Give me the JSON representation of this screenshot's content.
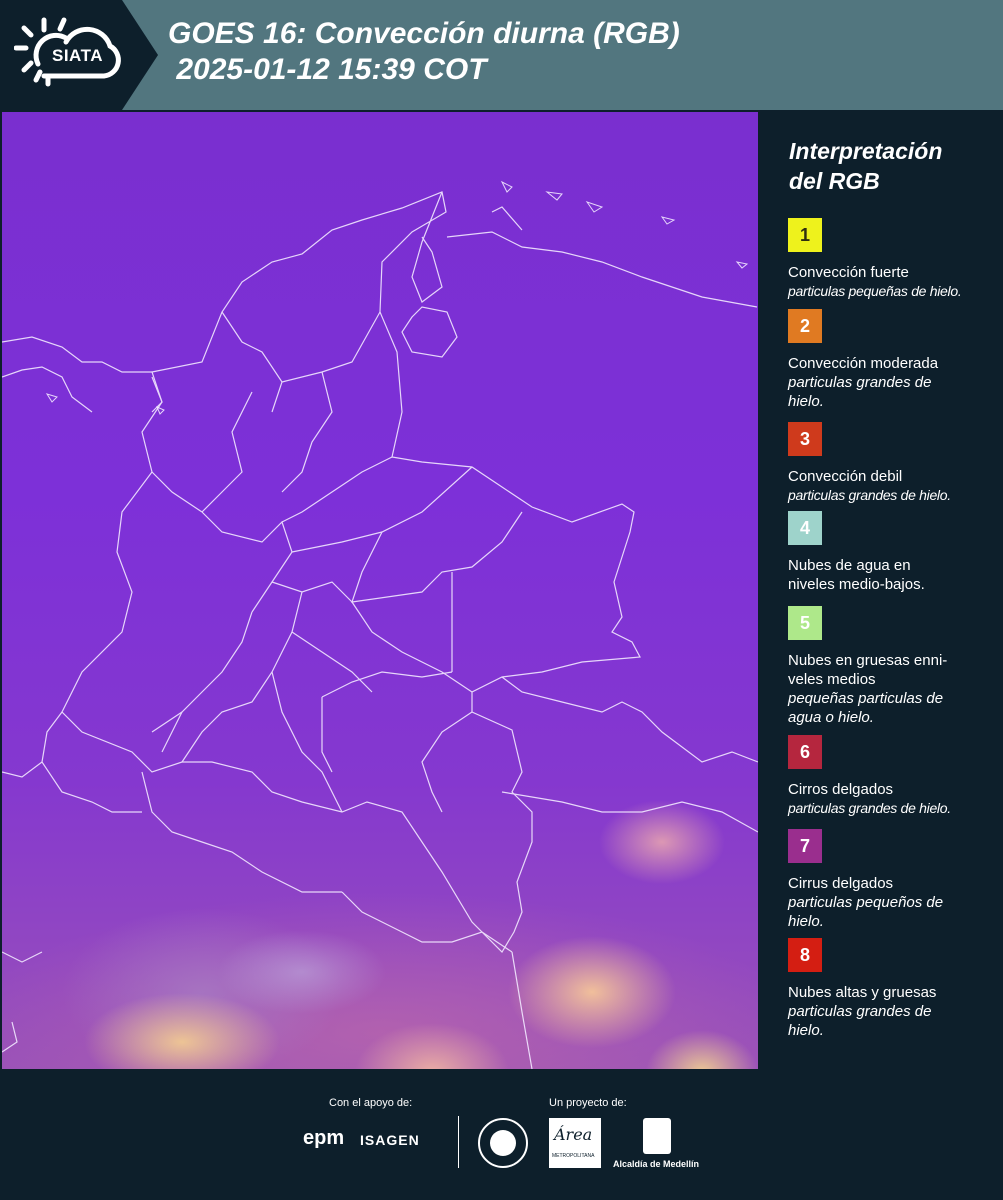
{
  "header": {
    "logo_text": "SIATA",
    "title": "GOES 16: Convección diurna (RGB)\n 2025-01-12 15:39 COT"
  },
  "legend": {
    "title_line1": "Interpretación",
    "title_line2": "del RGB",
    "items": [
      {
        "num": "1",
        "color": "#eef21c",
        "text_color": "#2e2e10",
        "label": "Convección fuerte",
        "desc": "particulas pequeñas de hielo."
      },
      {
        "num": "2",
        "color": "#e07a22",
        "text_color": "#ffffff",
        "label": "Convección moderada",
        "desc": "particulas grandes de hielo."
      },
      {
        "num": "3",
        "color": "#cf3a1c",
        "text_color": "#ffffff",
        "label": "Convección debil",
        "desc": "particulas grandes de hielo."
      },
      {
        "num": "4",
        "color": "#9ed3cb",
        "text_color": "#ffffff",
        "label": "Nubes de agua en niveles medio-bajos.",
        "desc": ""
      },
      {
        "num": "5",
        "color": "#aee88a",
        "text_color": "#ffffff",
        "label": "Nubes en gruesas enni-veles medios",
        "desc": "pequeñas particulas de agua o hielo."
      },
      {
        "num": "6",
        "color": "#b5263e",
        "text_color": "#ffffff",
        "label": "Cirros delgados",
        "desc": "particulas grandes de hielo."
      },
      {
        "num": "7",
        "color": "#9a2e8e",
        "text_color": "#ffffff",
        "label": "Cirrus delgados",
        "desc": "particulas pequeños de hielo."
      },
      {
        "num": "8",
        "color": "#d41e12",
        "text_color": "#ffffff",
        "label": "Nubes altas y gruesas",
        "desc": "particulas grandes de hielo."
      }
    ]
  },
  "footer": {
    "support_label": "Con el apoyo de:",
    "project_label": "Un proyecto de:",
    "sponsors": [
      "epm",
      "ISAGEN"
    ],
    "alcaldia": "Alcaldía de Medellín"
  }
}
